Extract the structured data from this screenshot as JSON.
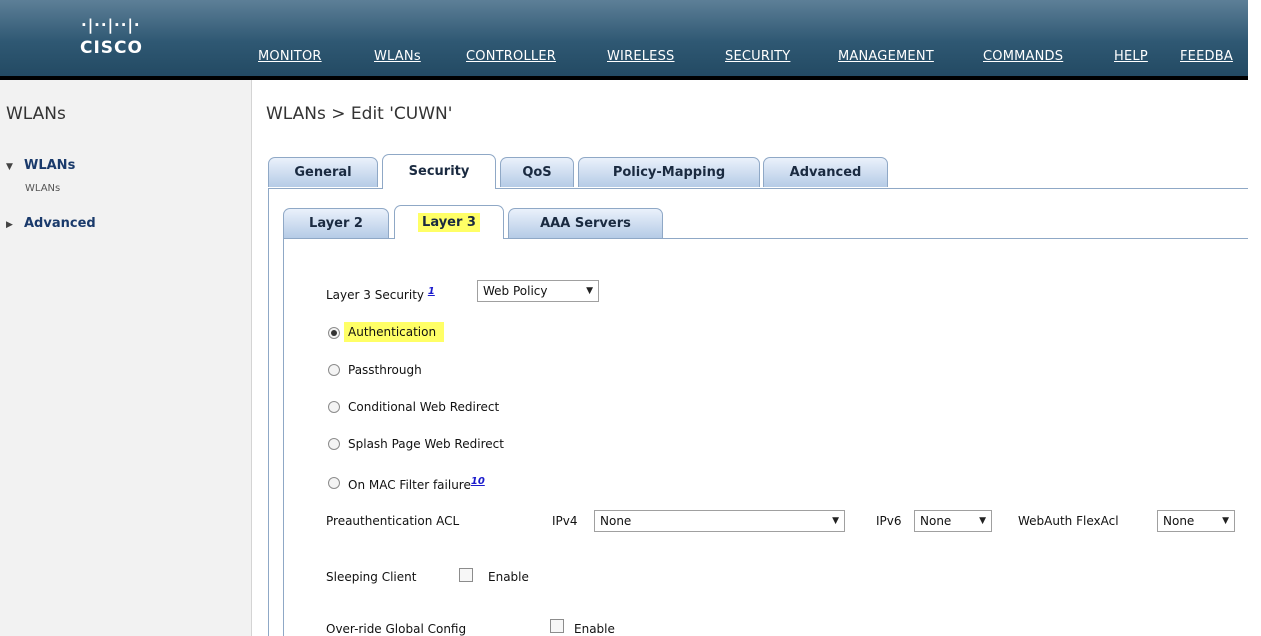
{
  "header": {
    "logo_bars": "·|··|··|·",
    "logo_text": "CISCO",
    "nav": [
      "MONITOR",
      "WLANs",
      "CONTROLLER",
      "WIRELESS",
      "SECURITY",
      "MANAGEMENT",
      "COMMANDS",
      "HELP",
      "FEEDBA"
    ]
  },
  "sidebar": {
    "title": "WLANs",
    "wlans_label": "WLANs",
    "wlans_sub": "WLANs",
    "advanced_label": "Advanced"
  },
  "page": {
    "title": "WLANs > Edit  'CUWN'"
  },
  "tabs": [
    "General",
    "Security",
    "QoS",
    "Policy-Mapping",
    "Advanced"
  ],
  "active_tab": "Security",
  "subtabs": [
    "Layer 2",
    "Layer 3",
    "AAA Servers"
  ],
  "active_subtab": "Layer 3",
  "layer3": {
    "security_label": "Layer 3 Security",
    "security_footnote": "1",
    "security_value": "Web Policy",
    "radios": [
      "Authentication",
      "Passthrough",
      "Conditional Web Redirect",
      "Splash Page Web Redirect",
      "On MAC Filter failure"
    ],
    "selected_radio": "Authentication",
    "mac_footnote": "10",
    "preauth_label": "Preauthentication ACL",
    "ipv4_label": "IPv4",
    "ipv4_value": "None",
    "ipv6_label": "IPv6",
    "ipv6_value": "None",
    "webauth_label": "WebAuth FlexAcl",
    "webauth_value": "None",
    "sleeping_label": "Sleeping Client",
    "sleeping_enable": "Enable",
    "override_label": "Over-ride Global Config",
    "override_enable": "Enable"
  },
  "colors": {
    "header": "#2f5873",
    "highlight": "#ffff66",
    "tab_border": "#8fa8c6"
  }
}
